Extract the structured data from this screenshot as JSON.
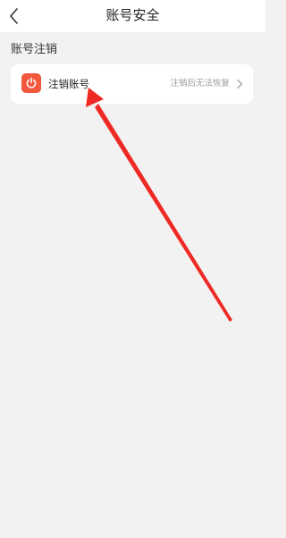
{
  "header": {
    "title": "账号安全",
    "back_icon": "chevron-left-icon"
  },
  "section": {
    "title": "账号注销"
  },
  "item": {
    "icon": "power-icon",
    "icon_color": "#f0573d",
    "label": "注销账号",
    "hint": "注销后无法恢复",
    "chevron_icon": "chevron-right-icon"
  },
  "colors": {
    "background": "#f2f2f2",
    "card": "#ffffff",
    "annotation_arrow": "#ee2a24"
  }
}
